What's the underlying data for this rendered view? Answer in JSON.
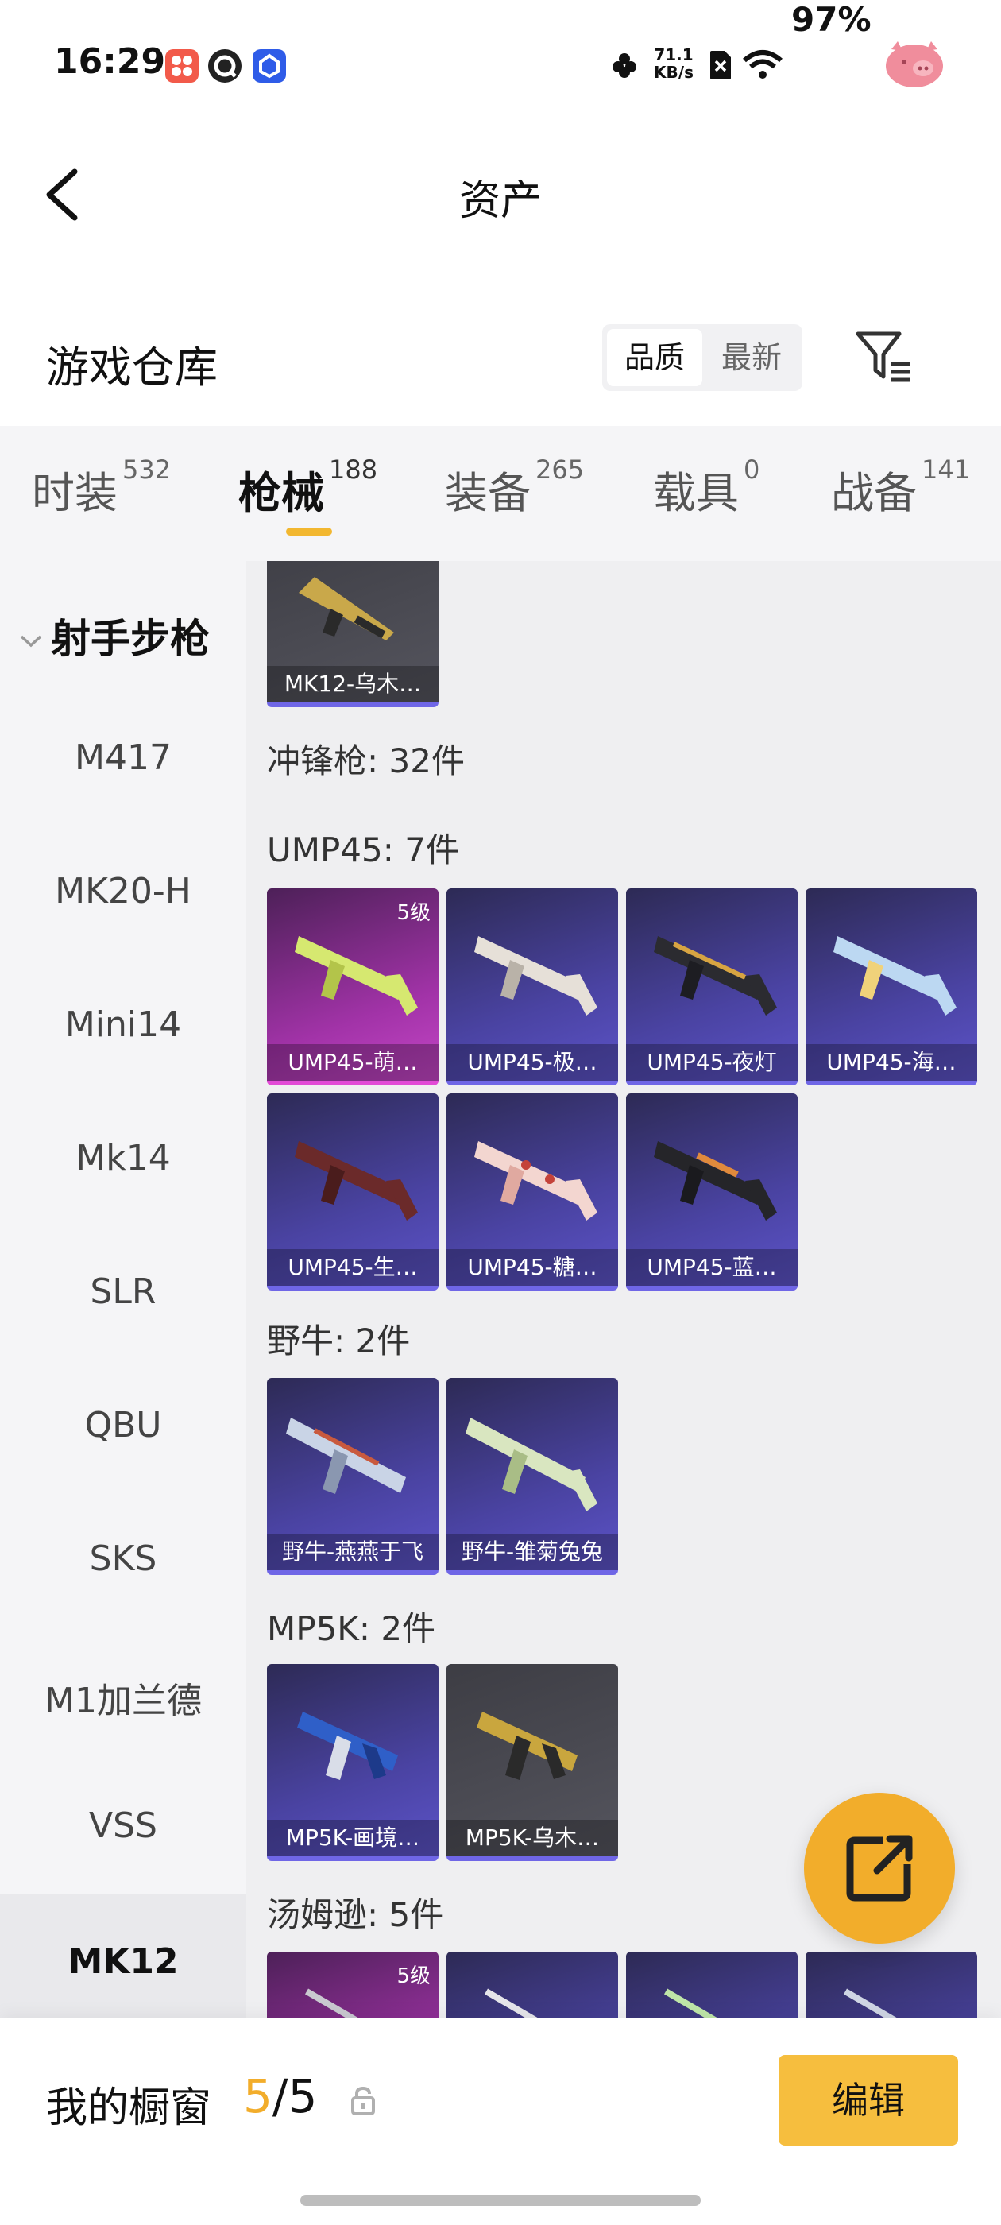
{
  "status_bar": {
    "time": "16:29",
    "speed_value": "71.1",
    "speed_unit": "KB/s",
    "battery": "97%",
    "icons": [
      "app-icon-1",
      "app-icon-2",
      "app-icon-3",
      "flower-icon",
      "sim-off-icon",
      "wifi-icon",
      "pig-avatar-icon"
    ]
  },
  "header": {
    "title": "资产",
    "back_icon": "chevron-left-icon"
  },
  "section": {
    "title": "游戏仓库",
    "sort_options": [
      "品质",
      "最新"
    ],
    "sort_selected": "品质",
    "filter_icon": "filter-list-icon"
  },
  "tabs": [
    {
      "label": "时装",
      "count": "532"
    },
    {
      "label": "枪械",
      "count": "188",
      "active": true
    },
    {
      "label": "装备",
      "count": "265"
    },
    {
      "label": "载具",
      "count": "0"
    },
    {
      "label": "战备",
      "count": "141"
    }
  ],
  "sidebar": {
    "group": "射手步枪",
    "group_icon": "chevron-down-icon",
    "items": [
      "M417",
      "MK20-H",
      "Mini14",
      "Mk14",
      "SLR",
      "QBU",
      "SKS",
      "M1加兰德",
      "VSS",
      "MK12"
    ],
    "active": "MK12"
  },
  "content": {
    "top_card": {
      "name": "MK12-乌木…"
    },
    "category_label": "冲锋枪: 32件",
    "groups": [
      {
        "label": "UMP45: 7件",
        "cards": [
          {
            "name": "UMP45-萌…",
            "level": "5级",
            "style": "pink"
          },
          {
            "name": "UMP45-极…",
            "style": "purple"
          },
          {
            "name": "UMP45-夜灯",
            "style": "purple"
          },
          {
            "name": "UMP45-海…",
            "style": "purple"
          },
          {
            "name": "UMP45-生…",
            "style": "purple"
          },
          {
            "name": "UMP45-糖…",
            "style": "purple"
          },
          {
            "name": "UMP45-蓝…",
            "style": "purple"
          }
        ]
      },
      {
        "label": "野牛: 2件",
        "cards": [
          {
            "name": "野牛-燕燕于飞",
            "style": "purple"
          },
          {
            "name": "野牛-雏菊兔兔",
            "style": "purple"
          }
        ]
      },
      {
        "label": "MP5K: 2件",
        "cards": [
          {
            "name": "MP5K-画境…",
            "style": "purple"
          },
          {
            "name": "MP5K-乌木…",
            "style": "grey"
          }
        ]
      },
      {
        "label": "汤姆逊: 5件",
        "cards": [
          {
            "name": "",
            "level": "5级",
            "style": "pink"
          },
          {
            "name": "",
            "style": "purple"
          },
          {
            "name": "",
            "style": "purple"
          },
          {
            "name": "",
            "style": "purple"
          }
        ]
      }
    ]
  },
  "fab": {
    "icon": "share-external-icon"
  },
  "bottom_bar": {
    "label": "我的橱窗",
    "count_current": "5",
    "count_sep": "/",
    "count_total": "5",
    "lock_icon": "lock-icon",
    "edit_label": "编辑"
  },
  "colors": {
    "accent": "#f2b730",
    "fab": "#f2ad2b",
    "edit_button": "#f6be3e",
    "card_purple": "#4a43a2",
    "card_pink": "#a233a8"
  }
}
